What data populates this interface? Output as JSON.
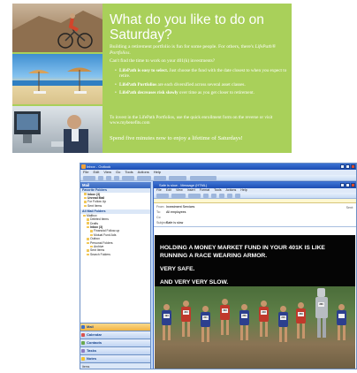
{
  "ad": {
    "headline": "What do you like to do on Saturday?",
    "intro_prefix": "Building a retirement portfolio is fun for some people. For others, there's ",
    "intro_brand": "LifePath® Portfolios",
    "intro_suffix": ".",
    "question": "Can't find the time to work on your 401(k) investments?",
    "bullets": [
      {
        "bold": "LifePath is easy to select.",
        "text": " Just choose the fund with the date closest to when you expect to retire."
      },
      {
        "bold": "LifePath Portfolios",
        "text": " are each diversified across several asset classes."
      },
      {
        "bold": "LifePath decreases risk slowly",
        "text": " over time as you get closer to retirement."
      }
    ],
    "invest": "To invest in the LifePath Portfolios, use the quick enrollment form on the reverse or visit www.mybenefits.com",
    "cta": "Spend five minutes now to enjoy a lifetime of Saturdays!"
  },
  "outlook": {
    "window_title": "Inbox - Outlook",
    "menu": [
      "File",
      "Edit",
      "View",
      "Go",
      "Tools",
      "Actions",
      "Help"
    ],
    "nav_header": "Mail",
    "sections": {
      "favorites": "Favorite Folders",
      "all_folders": "All Mail Folders"
    },
    "favorites": [
      "Inbox (3)",
      "Unread Mail",
      "For Follow Up",
      "Sent Items"
    ],
    "folders": [
      "Mailbox",
      "Deleted Items",
      "Drafts",
      "Inbox (3)",
      "Financial Follow-up",
      "Mutual Fund Ads",
      "Outbox",
      "Personal Folders",
      "Archive",
      "Sent Items",
      "Search Folders"
    ],
    "nav_buttons": [
      "Mail",
      "Calendar",
      "Contacts",
      "Tasks",
      "Notes"
    ],
    "status": "Items"
  },
  "message": {
    "window_title": "Safe is slow - Message (HTML)",
    "menu": [
      "File",
      "Edit",
      "View",
      "Insert",
      "Format",
      "Tools",
      "Actions",
      "Help"
    ],
    "header": {
      "from_label": "From:",
      "from": "Investment Services",
      "to_label": "To:",
      "to": "All employees",
      "cc_label": "Cc:",
      "subject_label": "Subject:",
      "subject": "Safe is slow",
      "sent_label": "Sent:"
    },
    "body": {
      "line1": "HOLDING A MONEY MARKET FUND IN YOUR 401K IS LIKE RUNNING A RACE WEARING ARMOR.",
      "line2": "VERY SAFE.",
      "line3": "AND VERY VERY SLOW."
    },
    "bibs": [
      "193",
      "264",
      "241",
      "293",
      "256",
      "248",
      "216",
      "269",
      "266"
    ]
  },
  "colors": {
    "ad_green": "#a9d05a",
    "outlook_blue": "#c3daf9",
    "titlebar_blue": "#1c4db3",
    "message_black": "#050505",
    "active_nav": "#f2b443"
  }
}
